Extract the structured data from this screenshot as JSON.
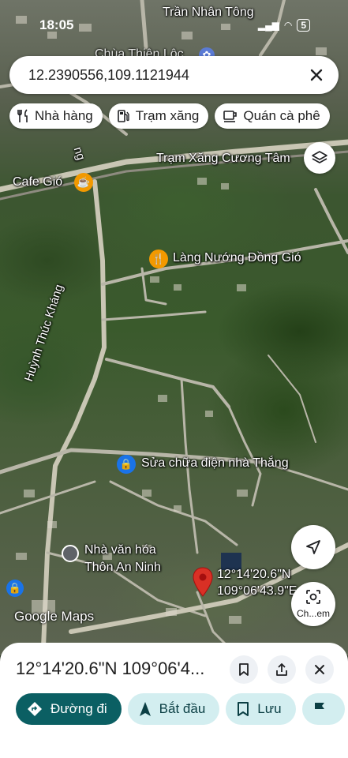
{
  "status_bar": {
    "time": "18:05",
    "battery": "5"
  },
  "search": {
    "value": "12.2390556,109.1121944"
  },
  "chips": [
    {
      "label": "Nhà hàng",
      "icon": "restaurant-icon"
    },
    {
      "label": "Trạm xăng",
      "icon": "gas-station-icon"
    },
    {
      "label": "Quán cà phê",
      "icon": "coffee-icon"
    }
  ],
  "map": {
    "labels": {
      "road_top": "Trần Nhân Tông",
      "temple_partial": "Chùa Thiện Lộc",
      "gas_station": "Trạm Xăng Cương Tâm",
      "cafe": "Cafe Gió",
      "restaurant": "Làng Nướng Đồng Gió",
      "street": "Huỳnh Thúc Kháng",
      "street_partial": "ng",
      "repair": "Sửa chữa điện nhà Thắng",
      "culture_house_1": "Nhà văn hóa",
      "culture_house_2": "Thôn An Ninh",
      "pin_lat": "12°14'20.6\"N",
      "pin_lng": "109°06'43.9\"E"
    },
    "watermark": "Google Maps",
    "lens_label": "Ch...em"
  },
  "sheet": {
    "title": "12°14'20.6\"N 109°06'4...",
    "actions": [
      {
        "label": "Đường đi",
        "icon": "directions-icon"
      },
      {
        "label": "Bắt đầu",
        "icon": "navigation-arrow-icon"
      },
      {
        "label": "Lưu",
        "icon": "bookmark-icon"
      },
      {
        "label": "",
        "icon": "flag-icon"
      }
    ]
  },
  "colors": {
    "primary": "#0b5f63",
    "secondary": "#d3eef0",
    "pin": "#d93025",
    "poi_orange": "#f29900",
    "poi_blue": "#1a73e8"
  }
}
